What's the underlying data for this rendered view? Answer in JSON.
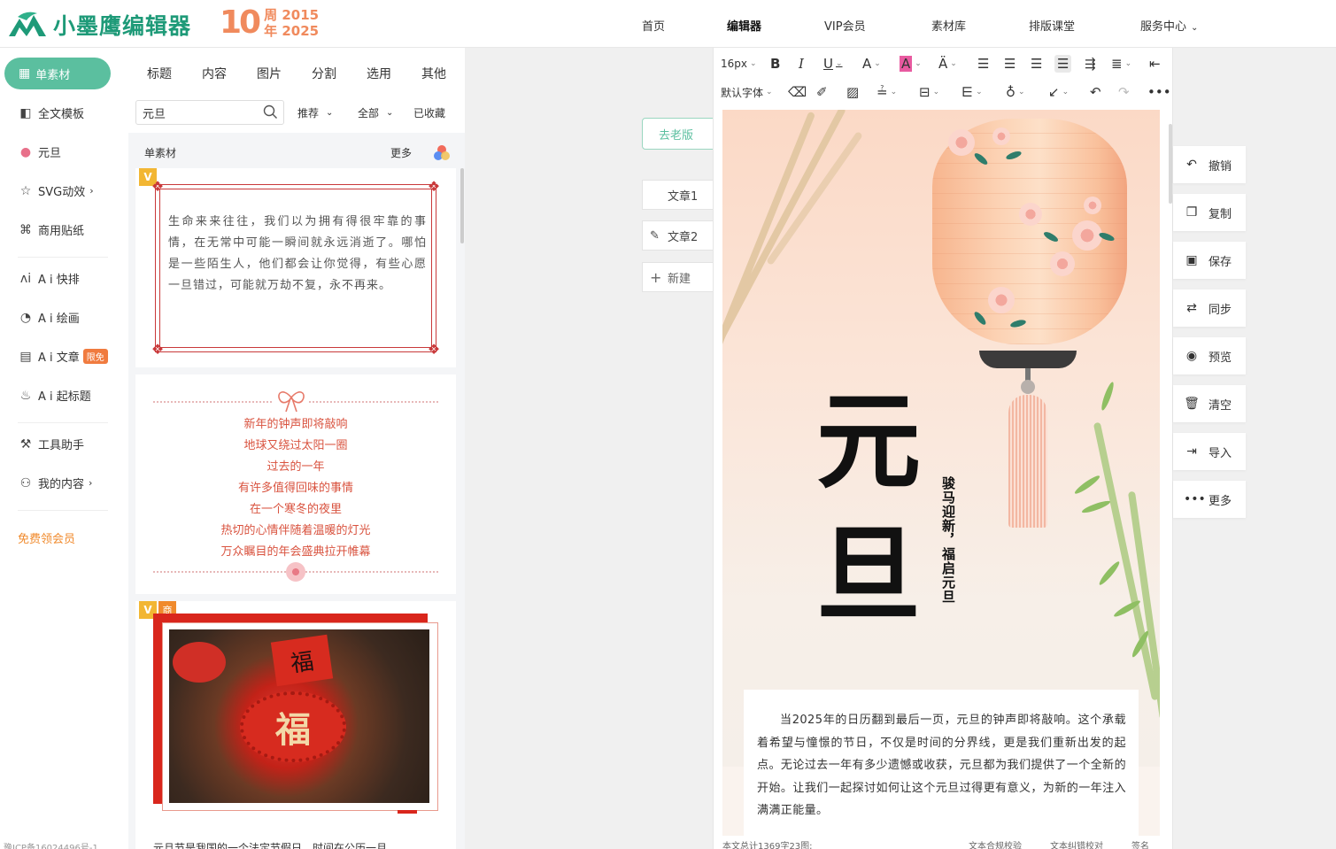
{
  "header": {
    "logo_text": "小墨鹰编辑器",
    "anniv_number": "10",
    "anniv_line1": "周 2015",
    "anniv_line2": "年 2025",
    "nav": [
      {
        "label": "首页"
      },
      {
        "label": "编辑器"
      },
      {
        "label": "VIP会员"
      },
      {
        "label": "素材库"
      },
      {
        "label": "排版课堂"
      },
      {
        "label": "服务中心"
      }
    ],
    "brand_color": "#1e9a78"
  },
  "sidebar": {
    "primary": "单素材",
    "items": [
      {
        "label": "全文模板"
      },
      {
        "label": "元旦"
      },
      {
        "label": "SVG动效"
      },
      {
        "label": "商用贴纸"
      },
      {
        "label": "A i 快排"
      },
      {
        "label": "A i 绘画"
      },
      {
        "label": "A i 文章"
      },
      {
        "label": "A i 起标题"
      },
      {
        "label": "工具助手"
      },
      {
        "label": "我的内容"
      }
    ],
    "limit_badge": "限免",
    "vip_link": "免费领会员",
    "icp": "豫ICP备16024496号-1",
    "accent": "#5bbf9f"
  },
  "materials": {
    "tabs": [
      "标题",
      "内容",
      "图片",
      "分割",
      "选用",
      "其他"
    ],
    "search_value": "元旦",
    "filters": [
      "推荐",
      "全部",
      "已收藏"
    ],
    "section_title": "单素材",
    "more": "更多",
    "tag_v": "V",
    "tag_shang": "商",
    "card1_text": "生命来来往往，我们以为拥有得很牢靠的事情，在无常中可能一瞬间就永远消逝了。哪怕是一些陌生人，他们都会让你觉得，有些心愿一旦错过，可能就万劫不复，永不再来。",
    "poem": [
      "新年的钟声即将敲响",
      "地球又绕过太阳一圈",
      "过去的一年",
      "有许多值得回味的事情",
      "在一个寒冬的夜里",
      "热切的心情伴随着温暖的灯光",
      "万众瞩目的年会盛典拉开帷幕"
    ],
    "fu_char": "福",
    "card3_caption": "元旦节是我国的一个法定节假日，时间在公历一月"
  },
  "articles": {
    "old_version": "去老版",
    "tabs": [
      "文章1",
      "文章2"
    ],
    "new": "新建"
  },
  "editor": {
    "font_size": "16px",
    "font_family": "默认字体",
    "title_chars": "元旦",
    "vertical_text": "骏马迎新，福启元旦",
    "body": "当2025年的日历翻到最后一页，元旦的钟声即将敲响。这个承载着希望与憧憬的节日，不仅是时间的分界线，更是我们重新出发的起点。无论过去一年有多少遗憾或收获，元旦都为我们提供了一个全新的开始。让我们一起探讨如何让这个元旦过得更有意义，为新的一年注入满满正能量。",
    "status_count": "本文总计1369字23图;",
    "status_check1": "文本合规校验",
    "status_check2": "文本纠错校对",
    "status_sign": "签名"
  },
  "actions": [
    "撤销",
    "复制",
    "保存",
    "同步",
    "预览",
    "清空",
    "导入",
    "更多"
  ]
}
